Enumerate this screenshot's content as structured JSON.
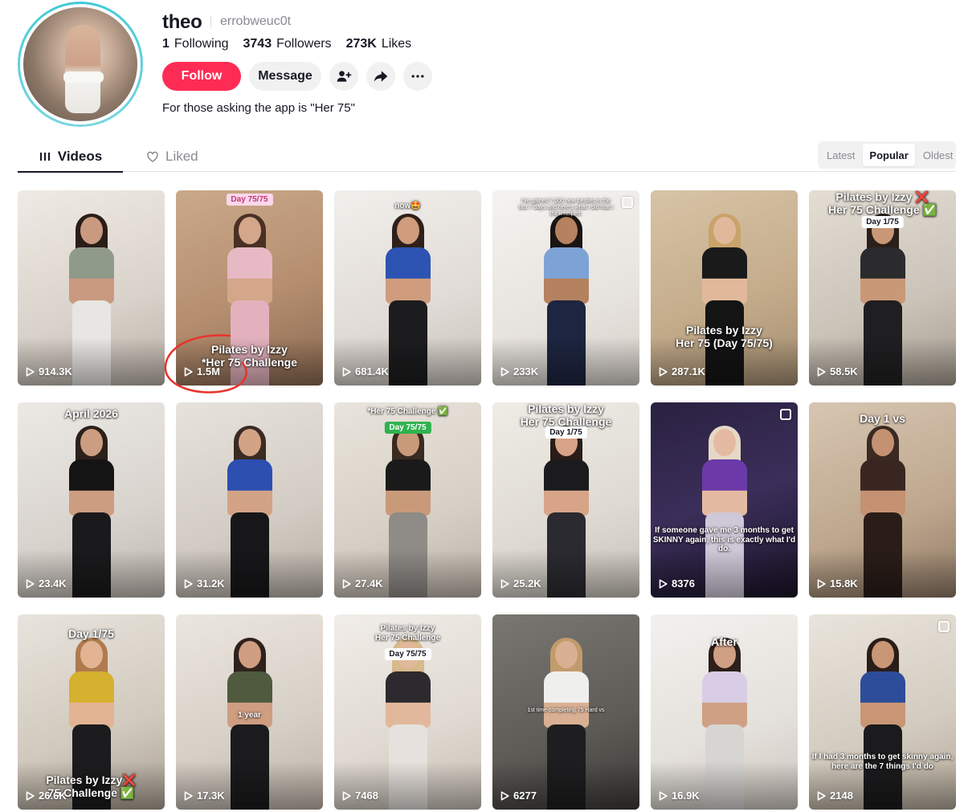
{
  "profile": {
    "username": "theo",
    "handle": "errobweuc0t",
    "stats": {
      "following_value": "1",
      "following_label": "Following",
      "followers_value": "3743",
      "followers_label": "Followers",
      "likes_value": "273K",
      "likes_label": "Likes"
    },
    "buttons": {
      "follow": "Follow",
      "message": "Message"
    },
    "bio": "For those asking the app is \"Her 75\""
  },
  "tabs": {
    "videos": "Videos",
    "liked": "Liked"
  },
  "sort": {
    "latest": "Latest",
    "popular": "Popular",
    "oldest": "Oldest",
    "selected": "Popular"
  },
  "videos": [
    {
      "views": "914.3K"
    },
    {
      "views": "1.5M",
      "pill": "Day 75/75",
      "caption": "Pilates by Izzy\n*Her 75 Challenge"
    },
    {
      "views": "681.4K",
      "caption": "now🤩"
    },
    {
      "views": "233K",
      "caption": "I've gained 7,000 new besties in the last 7 days and here's what I did that I think helped:"
    },
    {
      "views": "287.1K",
      "caption": "Pilates by Izzy\nHer 75 (Day 75/75)"
    },
    {
      "views": "58.5K",
      "caption": "Pilates by Izzy ❌\nHer 75 Challenge ✅",
      "pill": "Day 1/75"
    },
    {
      "views": "23.4K",
      "caption": "April 2026"
    },
    {
      "views": "31.2K"
    },
    {
      "views": "27.4K",
      "caption": "*Her 75 Challenge ✅",
      "pill": "Day 75/75"
    },
    {
      "views": "25.2K",
      "caption": "Pilates by Izzy\nHer 75 Challenge",
      "pill": "Day 1/75"
    },
    {
      "views": "8376",
      "caption": "If someone gave me 3 months to get SKINNY again, this is exactly what I'd do."
    },
    {
      "views": "15.8K",
      "caption": "Day 1 vs"
    },
    {
      "views": "26.6K",
      "caption": "Day 1/75",
      "caption2": "Pilates by Izzy❌\n75 Challenge ✅"
    },
    {
      "views": "17.3K",
      "caption": "1 year"
    },
    {
      "views": "7468",
      "caption": "Pilates by Izzy\nHer 75 Challenge",
      "pill": "Day 75/75"
    },
    {
      "views": "6277",
      "caption": "1st time completing 75 Hard vs"
    },
    {
      "views": "16.9K",
      "caption": "After"
    },
    {
      "views": "2148",
      "caption": "If I had 3 months to get skinny again, here are the 7 things I'd do"
    }
  ],
  "colors": {
    "accent": "#fe2c55",
    "ring": "#3ec9d6",
    "annotation": "#e8332a"
  }
}
